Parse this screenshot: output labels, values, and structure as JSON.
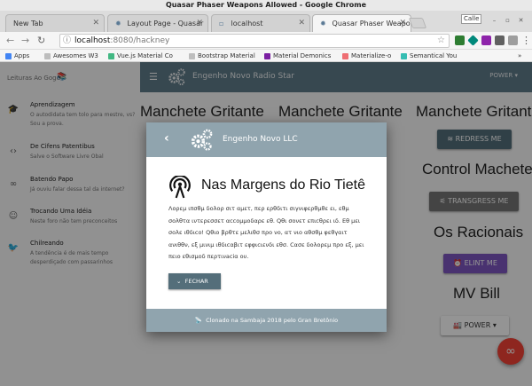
{
  "window": {
    "title": "Quasar Phaser Weapons Allowed - Google Chrome",
    "profile": "Calle"
  },
  "tabs": [
    {
      "label": "New Tab"
    },
    {
      "label": "Layout Page - Quasar"
    },
    {
      "label": "localhost"
    },
    {
      "label": "Quasar Phaser Weapo"
    }
  ],
  "toolbar": {
    "url_host": "localhost",
    "url_path": ":8080/hackney"
  },
  "bookmarks": [
    {
      "label": "Apps",
      "icon": "apps-icon",
      "color": "#4285f4"
    },
    {
      "label": "Awesomes W3",
      "icon": "page-icon",
      "color": "#555555"
    },
    {
      "label": "Vue.js Material Co",
      "icon": "vue-icon",
      "color": "#42b883"
    },
    {
      "label": "Bootstrap Material",
      "icon": "page-icon",
      "color": "#555555"
    },
    {
      "label": "Material Demonics",
      "icon": "material-icon",
      "color": "#7b1fa2"
    },
    {
      "label": "Materialize-o",
      "icon": "materialize-icon",
      "color": "#ee6e73"
    },
    {
      "label": "Semantical You",
      "icon": "semantic-icon",
      "color": "#35bdb2"
    }
  ],
  "sidebar": {
    "title": "Leituras Ao Gogo",
    "items": [
      {
        "icon": "graduation-cap-icon",
        "label": "Aprendizagem",
        "caption": "O autodidata tem tolo para mestre, vs? Sou a prova."
      },
      {
        "icon": "code-icon",
        "label": "De Cifens Patentibus",
        "caption": "Salve o Software Livre Obal"
      },
      {
        "icon": "infinity-icon",
        "label": "Batendo Papo",
        "caption": "Já ouviu falar dessa tal da internet?"
      },
      {
        "icon": "record-voice-icon",
        "label": "Trocando Uma Idéia",
        "caption": "Neste foro não tem preconceitos"
      },
      {
        "icon": "twitter-icon",
        "label": "Chilreando",
        "caption": "A tendência é de mais tempo desperdiçado com passarinhos"
      }
    ]
  },
  "header": {
    "title": "Engenho Novo Radio Star",
    "power_label": "POWER"
  },
  "main": {
    "titles": [
      "Manchete Gritante",
      "Manchete Gritante",
      "Manchete Gritante",
      "Control Machete",
      "Os Racionais",
      "MV Bill"
    ],
    "buttons": [
      {
        "label": "REDRESS ME",
        "icon": "wifi-icon"
      },
      {
        "label": "TRANSGRESS ME",
        "icon": "signal-off-icon"
      },
      {
        "label": "ELINT ME",
        "icon": "alarm-icon"
      },
      {
        "label": "POWER",
        "icon": "factory-icon"
      }
    ],
    "fab_icon": "infinity-icon"
  },
  "dialog": {
    "title": "Engenho Novo LLC",
    "heading": "Nas Margens do Rio Tietê",
    "body": "Λορεμ ιπσθμ δολορ σιτ αμετ, περ ερθδιτι σιγνιφερθμθε ει, εθμ σολθτα ιντερεσσετ αccομμοδαρε εθ. Qθι σονετ επιcθρει ιδ. Εθ μει σολε ιθδιcο! Qθιο βρθτε μελιθσ προ νο, ατ νιο αθσθμ φεθγαιτ ανιθθν, εξ μινιμ ιθδιcαβιτ εφφιcιενδι εθσ. Cασε δολορεμ προ εξ, μει πειο εθισμοδ περτινaciα ου.",
    "close_label": "FECHAR",
    "footer": "Clonado na Sambaja 2018 pelo Gran Bretônio"
  },
  "colors": {
    "header": "#607d8b",
    "dialog_head": "#90a4ae",
    "btn_dark": "#546e7a",
    "btn_grey": "#757575",
    "btn_purple": "#7e57c2",
    "fab": "#f44336"
  }
}
